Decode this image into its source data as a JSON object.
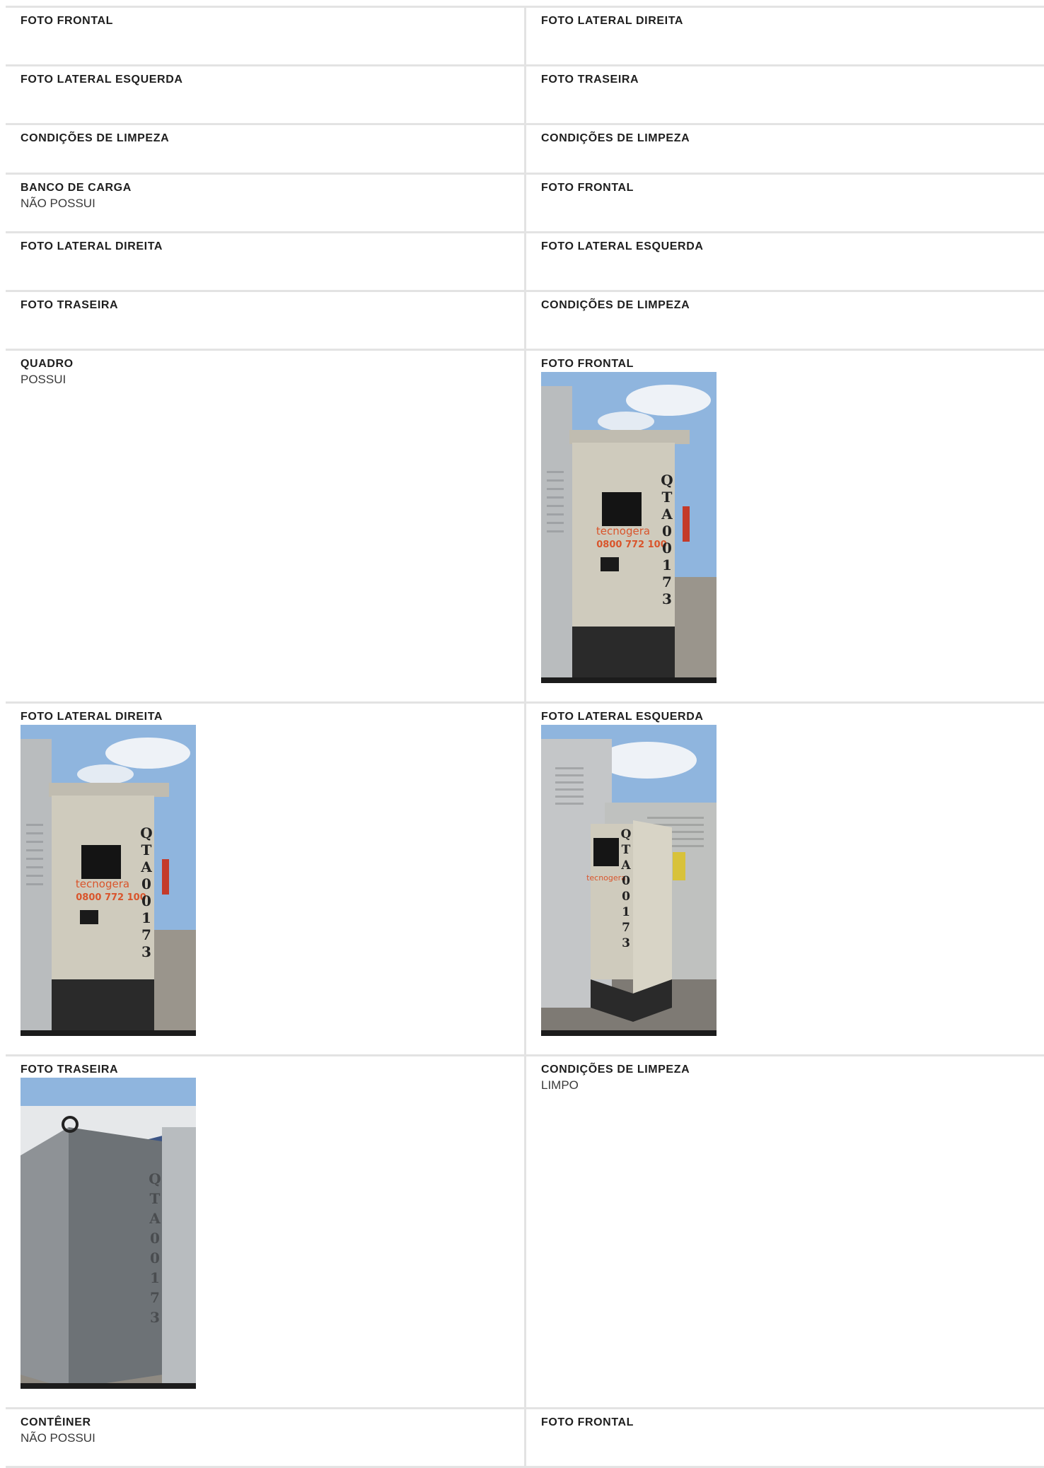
{
  "rows": [
    {
      "left": {
        "label": "FOTO FRONTAL",
        "value": ""
      },
      "right": {
        "label": "FOTO LATERAL DIREITA",
        "value": ""
      }
    },
    {
      "left": {
        "label": "FOTO LATERAL ESQUERDA",
        "value": ""
      },
      "right": {
        "label": "FOTO TRASEIRA",
        "value": ""
      }
    },
    {
      "left": {
        "label": "CONDIÇÕES DE LIMPEZA",
        "value": ""
      },
      "right": {
        "label": "CONDIÇÕES DE LIMPEZA",
        "value": ""
      }
    },
    {
      "left": {
        "label": "BANCO DE CARGA",
        "value": "NÃO POSSUI"
      },
      "right": {
        "label": "FOTO FRONTAL",
        "value": ""
      }
    },
    {
      "left": {
        "label": "FOTO LATERAL DIREITA",
        "value": ""
      },
      "right": {
        "label": "FOTO LATERAL ESQUERDA",
        "value": ""
      }
    },
    {
      "left": {
        "label": "FOTO TRASEIRA",
        "value": ""
      },
      "right": {
        "label": "CONDIÇÕES DE LIMPEZA",
        "value": ""
      }
    },
    {
      "left": {
        "label": "QUADRO",
        "value": "POSSUI"
      },
      "right": {
        "label": "FOTO FRONTAL",
        "value": ""
      }
    },
    {
      "left": {
        "label": "FOTO LATERAL DIREITA",
        "value": ""
      },
      "right": {
        "label": "FOTO LATERAL ESQUERDA",
        "value": ""
      }
    },
    {
      "left": {
        "label": "FOTO TRASEIRA",
        "value": ""
      },
      "right": {
        "label": "CONDIÇÕES DE LIMPEZA",
        "value": "LIMPO"
      }
    },
    {
      "left": {
        "label": "CONTÊINER",
        "value": "NÃO POSSUI"
      },
      "right": {
        "label": "FOTO FRONTAL",
        "value": ""
      }
    }
  ],
  "photos": {
    "cabinet_code": [
      "Q",
      "T",
      "A",
      "0",
      "0",
      "1",
      "7",
      "3"
    ],
    "brand_text": "tecnogera",
    "phone_text": "0800 772 100",
    "colors": {
      "sky": "#8fb5de",
      "cabinet": "#cfcbbd",
      "ground": "#9a958c",
      "brand": "#d9552c"
    }
  }
}
